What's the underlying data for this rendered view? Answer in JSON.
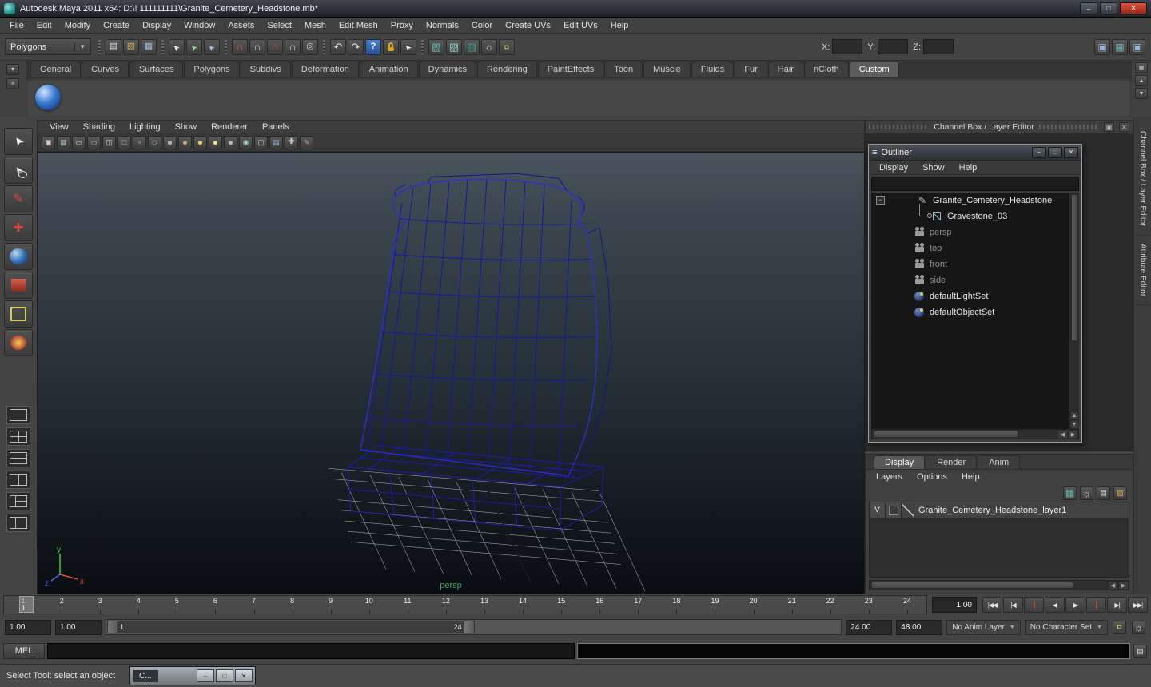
{
  "titlebar": {
    "title": "Autodesk Maya 2011 x64: D:\\! 111111111\\Granite_Cemetery_Headstone.mb*"
  },
  "menubar": {
    "items": [
      "File",
      "Edit",
      "Modify",
      "Create",
      "Display",
      "Window",
      "Assets",
      "Select",
      "Mesh",
      "Edit Mesh",
      "Proxy",
      "Normals",
      "Color",
      "Create UVs",
      "Edit UVs",
      "Help"
    ]
  },
  "statusline": {
    "mode_dropdown": "Polygons",
    "coord_labels": {
      "x": "X:",
      "y": "Y:",
      "z": "Z:"
    },
    "groups": {
      "file": [
        {
          "name": "new-scene-icon",
          "cls": "page"
        },
        {
          "name": "open-scene-icon",
          "cls": "folder"
        },
        {
          "name": "save-scene-icon",
          "cls": "disk"
        }
      ],
      "selection": [
        {
          "name": "select-by-hierarchy-icon",
          "cls": "cursor"
        },
        {
          "name": "select-by-object-type-icon",
          "cls": "cursor2"
        },
        {
          "name": "select-by-component-type-icon",
          "cls": "cursor3"
        }
      ],
      "snapping": [
        {
          "name": "snap-to-grids-icon",
          "cls": "magnet"
        },
        {
          "name": "snap-to-curves-icon",
          "cls": "magnet2"
        },
        {
          "name": "snap-to-points-icon",
          "cls": "magnet"
        },
        {
          "name": "snap-to-view-planes-icon",
          "cls": "magnet2"
        },
        {
          "name": "make-object-live-icon",
          "cls": "live"
        }
      ],
      "history": [
        {
          "name": "undo-icon",
          "cls": "undo"
        },
        {
          "name": "redo-icon",
          "cls": "redo"
        },
        {
          "name": "help-icon",
          "cls": "question"
        },
        {
          "name": "lock-selection-icon",
          "cls": "lockc"
        },
        {
          "name": "highlight-selection-icon",
          "cls": "cursor"
        }
      ],
      "render": [
        {
          "name": "open-render-view-icon",
          "cls": "clap"
        },
        {
          "name": "render-current-frame-icon",
          "cls": "clap2"
        },
        {
          "name": "ipr-render-icon",
          "cls": "clap3"
        },
        {
          "name": "render-settings-icon",
          "cls": "gear"
        },
        {
          "name": "paint-effects-panel-icon",
          "cls": "keys"
        }
      ],
      "sidebar": [
        {
          "name": "toggle-attribute-editor-icon",
          "cls": "bluebox"
        },
        {
          "name": "toggle-tool-settings-icon",
          "cls": "tealgrid"
        },
        {
          "name": "toggle-channel-box-icon",
          "cls": "bluebox"
        }
      ]
    }
  },
  "shelf": {
    "tabs": [
      {
        "label": "General"
      },
      {
        "label": "Curves"
      },
      {
        "label": "Surfaces"
      },
      {
        "label": "Polygons"
      },
      {
        "label": "Subdivs"
      },
      {
        "label": "Deformation"
      },
      {
        "label": "Animation"
      },
      {
        "label": "Dynamics"
      },
      {
        "label": "Rendering"
      },
      {
        "label": "PaintEffects"
      },
      {
        "label": "Toon"
      },
      {
        "label": "Muscle"
      },
      {
        "label": "Fluids"
      },
      {
        "label": "Fur"
      },
      {
        "label": "Hair"
      },
      {
        "label": "nCloth"
      },
      {
        "label": "Custom",
        "active": true
      }
    ]
  },
  "toolbox": {
    "tools": [
      {
        "name": "select-tool",
        "cls": "t-select"
      },
      {
        "name": "lasso-tool",
        "cls": "t-lasso"
      },
      {
        "name": "paint-selection-tool",
        "cls": "t-paint"
      },
      {
        "name": "move-tool",
        "cls": "t-move"
      },
      {
        "name": "rotate-tool",
        "cls": "t-rotate"
      },
      {
        "name": "scale-tool",
        "cls": "t-scale"
      },
      {
        "name": "universal-manipulator-tool",
        "cls": "t-universal"
      },
      {
        "name": "soft-modification-tool",
        "cls": "t-soft"
      }
    ],
    "layouts": [
      {
        "name": "layout-single-pane-button",
        "cls": "l1"
      },
      {
        "name": "layout-four-pane-button",
        "cls": "l4"
      },
      {
        "name": "layout-two-pane-stacked-button",
        "cls": "l2h"
      },
      {
        "name": "layout-two-pane-side-button",
        "cls": "l2v"
      },
      {
        "name": "layout-three-pane-button",
        "cls": "l3"
      },
      {
        "name": "layout-outliner-persp-button",
        "cls": "l2o"
      }
    ]
  },
  "panel": {
    "menus": [
      "View",
      "Shading",
      "Lighting",
      "Show",
      "Renderer",
      "Panels"
    ],
    "view_label": "persp",
    "toolbar_icons": [
      {
        "name": "select-camera-icon",
        "cls": "camv"
      },
      {
        "name": "grid-icon",
        "cls": "fchart"
      },
      {
        "name": "film-gate-icon",
        "cls": "fgate"
      },
      {
        "name": "resolution-gate-icon",
        "cls": "rgate"
      },
      {
        "name": "gate-mask-icon",
        "cls": "maskic"
      },
      {
        "name": "safe-action-icon",
        "cls": "sact"
      },
      {
        "name": "safe-title-icon",
        "cls": "stit"
      },
      {
        "name": "wireframe-icon",
        "cls": "wf"
      },
      {
        "name": "shaded-mode-icon",
        "cls": "sphgray"
      },
      {
        "name": "textured-mode-icon",
        "cls": "sphtex"
      },
      {
        "name": "use-default-lighting-icon",
        "cls": "lamp"
      },
      {
        "name": "use-all-lights-icon",
        "cls": "lamp2"
      },
      {
        "name": "shadows-icon",
        "cls": "sphgray"
      },
      {
        "name": "xray-icon",
        "cls": "xr"
      },
      {
        "name": "isolate-select-icon",
        "cls": "iso"
      },
      {
        "name": "image-plane-icon",
        "cls": "imgp"
      },
      {
        "name": "2d-pan-zoom-icon",
        "cls": "campan"
      },
      {
        "name": "grease-pencil-icon",
        "cls": "gp"
      }
    ]
  },
  "outliner": {
    "title": "Outliner",
    "menus": [
      "Display",
      "Show",
      "Help"
    ],
    "search_value": "",
    "items": [
      {
        "label": "Granite_Cemetery_Headstone"
      },
      {
        "label": "Gravestone_03"
      },
      {
        "label": "persp"
      },
      {
        "label": "top"
      },
      {
        "label": "front"
      },
      {
        "label": "side"
      },
      {
        "label": "defaultLightSet"
      },
      {
        "label": "defaultObjectSet"
      }
    ]
  },
  "channel_box": {
    "header": "Channel Box / Layer Editor"
  },
  "right_tabs": {
    "channel_box": "Channel Box / Layer Editor",
    "attribute_editor": "Attribute Editor"
  },
  "layer_editor": {
    "tabs": [
      {
        "label": "Display",
        "active": true
      },
      {
        "label": "Render"
      },
      {
        "label": "Anim"
      }
    ],
    "menus": [
      "Layers",
      "Options",
      "Help"
    ],
    "icons": [
      {
        "name": "edit-selected-layer-icon",
        "cls": "tealgrid"
      },
      {
        "name": "layer-options-icon",
        "cls": "gear"
      },
      {
        "name": "create-empty-layer-icon",
        "cls": "page"
      },
      {
        "name": "create-layer-assign-selected-icon",
        "cls": "folder"
      }
    ],
    "layers": [
      {
        "visible": "V",
        "name": "Granite_Cemetery_Headstone_layer1"
      }
    ]
  },
  "timeline": {
    "frames": [
      "1",
      "2",
      "3",
      "4",
      "5",
      "6",
      "7",
      "8",
      "9",
      "10",
      "11",
      "12",
      "13",
      "14",
      "15",
      "16",
      "17",
      "18",
      "19",
      "20",
      "21",
      "22",
      "23",
      "24"
    ],
    "current_frame": "1",
    "current_time_field": "1.00"
  },
  "transport": {
    "buttons": [
      {
        "name": "go-to-start-button",
        "glyph": "|◀◀"
      },
      {
        "name": "step-back-one-frame-button",
        "glyph": "|◀"
      },
      {
        "name": "step-back-one-key-button",
        "glyph": "|",
        "cls": "redkey"
      },
      {
        "name": "play-backwards-button",
        "glyph": "◀"
      },
      {
        "name": "play-forwards-button",
        "glyph": "▶"
      },
      {
        "name": "step-forward-one-key-button",
        "glyph": "|",
        "cls": "redkey"
      },
      {
        "name": "step-forward-one-frame-button",
        "glyph": "▶|"
      },
      {
        "name": "go-to-end-button",
        "glyph": "▶▶|"
      }
    ]
  },
  "range_slider": {
    "anim_start": "1.00",
    "playback_start": "1.00",
    "range_start": "1",
    "range_end": "24",
    "playback_end": "24.00",
    "anim_end": "48.00",
    "anim_layer": "No Anim Layer",
    "character_set": "No Character Set"
  },
  "command_line": {
    "label": "MEL"
  },
  "help_line": {
    "text": "Select Tool: select an object"
  },
  "mini_window": {
    "title": "C..."
  }
}
